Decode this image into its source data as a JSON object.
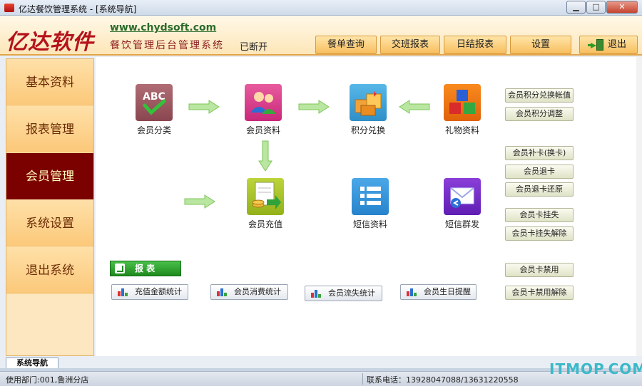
{
  "window": {
    "title": "亿达餐饮管理系统 - [系统导航]",
    "minimize": "▁",
    "maximize": "□",
    "close": "✕"
  },
  "header": {
    "logo": "亿达软件",
    "url": "www.chydsoft.com",
    "subtitle": "餐饮管理后台管理系统",
    "shift_status": "已断开",
    "toolbar": [
      "餐单查询",
      "交班报表",
      "日结报表",
      "设置"
    ],
    "exit_label": "退出"
  },
  "sidebar": {
    "items": [
      "基本资料",
      "报表管理",
      "会员管理",
      "系统设置",
      "退出系统"
    ],
    "active_index": 2
  },
  "features": {
    "member_category": "会员分类",
    "member_info": "会员资料",
    "points_redeem": "积分兑换",
    "gift_info": "礼物资料",
    "member_recharge": "会员充值",
    "sms_info": "短信资料",
    "sms_broadcast": "短信群发"
  },
  "side_buttons": [
    "会员积分兑换帐值",
    "会员积分调整",
    "会员补卡(换卡)",
    "会员退卡",
    "会员退卡还原",
    "会员卡挂失",
    "会员卡挂失解除",
    "会员卡禁用",
    "会员卡禁用解除"
  ],
  "reports": {
    "header": "报 表",
    "buttons": [
      "充值金额统计",
      "会员消费统计",
      "会员流失统计",
      "会员生日提醒"
    ]
  },
  "bottom": {
    "tab": "系统导航",
    "dept": "使用部门:001,鲁洲分店",
    "phone": "联系电话：13928047088/13631220558",
    "watermark": "ITMOP.COM"
  },
  "colors": {
    "sidebar_active": "#7b0000",
    "sidebar_bg": "#fbc879",
    "toolbar_bg": "#f7be5e",
    "report_green": "#1e8a1e"
  }
}
